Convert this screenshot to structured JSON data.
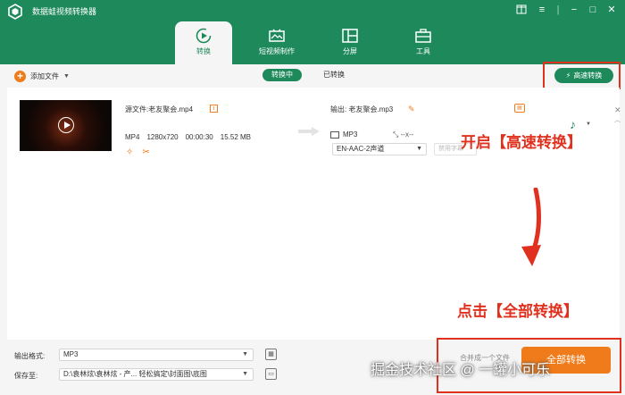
{
  "app": {
    "title": "数据蛙视频转换器"
  },
  "window_controls": [
    "gift-icon",
    "menu-icon",
    "minimize-icon",
    "maximize-icon",
    "close-icon"
  ],
  "nav": [
    {
      "label": "转换",
      "icon": "convert-icon",
      "active": true
    },
    {
      "label": "短视频制作",
      "icon": "video-maker-icon",
      "active": false
    },
    {
      "label": "分屏",
      "icon": "split-screen-icon",
      "active": false
    },
    {
      "label": "工具",
      "icon": "toolbox-icon",
      "active": false
    }
  ],
  "toolbar": {
    "add_file": "添加文件",
    "tab_converting": "转换中",
    "tab_converted": "已转换",
    "high_speed": "高速转换"
  },
  "file": {
    "source_label": "源文件:",
    "source_name": "老友聚会.mp4",
    "format": "MP4",
    "resolution": "1280x720",
    "duration": "00:00:30",
    "size": "15.52 MB",
    "output_label": "输出:",
    "output_name": "老友聚会.mp3",
    "output_format": "MP3",
    "output_dims": "--x--",
    "audio_track": "EN-AAC-2声道",
    "subtitle_placeholder": "禁用字幕"
  },
  "annotations": {
    "high_speed": "开启【高速转换】",
    "convert_all": "点击【全部转换】"
  },
  "bottom": {
    "output_format_label": "输出格式:",
    "output_format_value": "MP3",
    "save_to_label": "保存至:",
    "save_to_value": "D:\\袁林炫\\袁林炫 - 产... 轻松搞定\\封面图\\底图",
    "merge_label": "合并成一个文件",
    "convert_all": "全部转换"
  },
  "watermark": "掘金技术社区 @ 一罐小可乐",
  "colors": {
    "brand": "#1e8a5c",
    "accent": "#f07b1a",
    "annotation": "#e0301e"
  }
}
